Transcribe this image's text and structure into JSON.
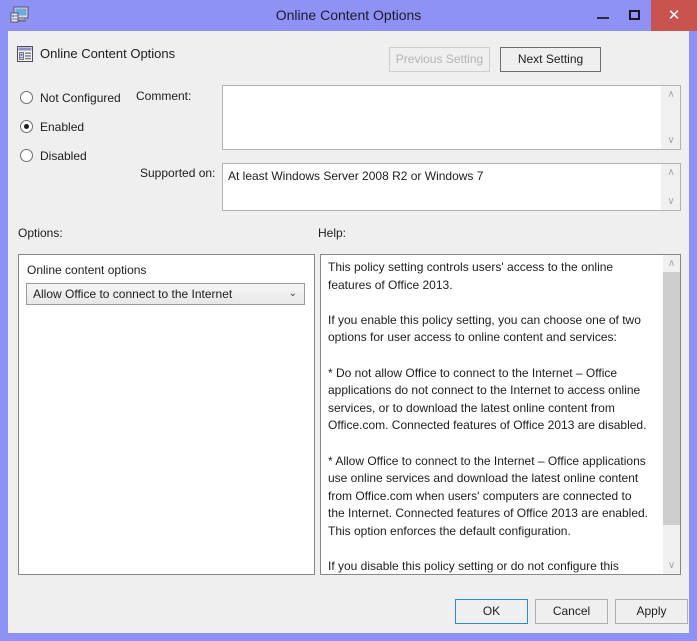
{
  "window": {
    "title": "Online Content Options",
    "icon": "policy-window-icon",
    "controls": {
      "minimize": "minimize-icon",
      "maximize": "maximize-icon",
      "close": "✕"
    }
  },
  "header": {
    "icon": "policy-setting-icon",
    "title": "Online Content Options",
    "previous_setting_label": "Previous Setting",
    "next_setting_label": "Next Setting"
  },
  "state_options": {
    "items": [
      {
        "label": "Not Configured",
        "selected": false
      },
      {
        "label": "Enabled",
        "selected": true
      },
      {
        "label": "Disabled",
        "selected": false
      }
    ]
  },
  "comment": {
    "label": "Comment:",
    "value": "",
    "placeholder": ""
  },
  "supported_on": {
    "label": "Supported on:",
    "value": "At least Windows Server 2008 R2 or Windows 7"
  },
  "options": {
    "label": "Options:",
    "group_label": "Online content options",
    "selected_value": "Allow Office to connect to the Internet",
    "choices": [
      "Do not allow Office to connect to the Internet",
      "Allow Office to connect to the Internet"
    ],
    "chevron": "⌄"
  },
  "help": {
    "label": "Help:",
    "text": "This policy setting controls users' access to the online features of Office 2013.\n\nIf you enable this policy setting, you can choose one of two options for user access to online content and services:\n\n* Do not allow Office to connect to the Internet – Office applications do not connect to the Internet to access online services, or to download the latest online content from Office.com. Connected features of Office 2013 are disabled.\n\n* Allow Office to connect to the Internet – Office applications use online services and download the latest online content from Office.com when users' computers are connected to the Internet. Connected features of Office 2013 are enabled. This option enforces the default configuration.\n\nIf you disable this policy setting or do not configure this policy setting, Office applications use online services and download the latest online content from Office.com when users' computers are connected to the Internet. Users can change this behavior by",
    "scroll_up_arrow": "∧",
    "scroll_down_arrow": "∨"
  },
  "footer": {
    "ok_label": "OK",
    "cancel_label": "Cancel",
    "apply_label": "Apply"
  },
  "colors": {
    "titlebar": "#8f92f5",
    "close_button": "#c9534f",
    "client_background": "#efeff0",
    "focus_border": "#2e8ad8",
    "panel_border": "#878787"
  }
}
